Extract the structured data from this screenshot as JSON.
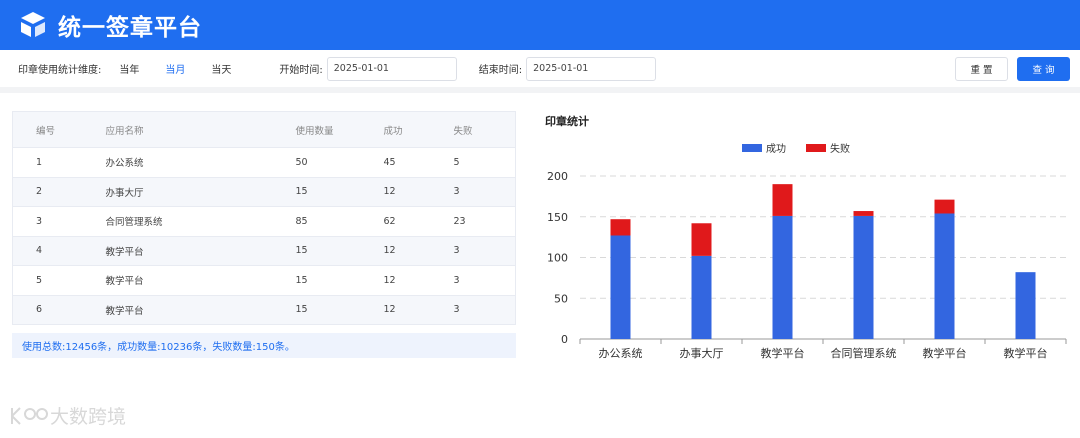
{
  "header": {
    "title": "统一签章平台",
    "logo_icon": "cube-stack-icon"
  },
  "filters": {
    "dimension_label": "印章使用统计维度:",
    "dimension_options": [
      "当年",
      "当月",
      "当天"
    ],
    "active_option": "当月",
    "start_label": "开始时间:",
    "start_value": "2025-01-01",
    "end_label": "结束时间:",
    "end_value": "2025-01-01",
    "reset_label": "重 置",
    "query_label": "查 询"
  },
  "table": {
    "columns": [
      "编号",
      "应用名称",
      "使用数量",
      "成功",
      "失败"
    ],
    "rows": [
      [
        "1",
        "办公系统",
        "50",
        "45",
        "5"
      ],
      [
        "2",
        "办事大厅",
        "15",
        "12",
        "3"
      ],
      [
        "3",
        "合同管理系统",
        "85",
        "62",
        "23"
      ],
      [
        "4",
        "教学平台",
        "15",
        "12",
        "3"
      ],
      [
        "5",
        "教学平台",
        "15",
        "12",
        "3"
      ],
      [
        "6",
        "教学平台",
        "15",
        "12",
        "3"
      ]
    ],
    "summary": "使用总数:12456条，成功数量:10236条，失败数量:150条。"
  },
  "chart_title": "印章统计",
  "chart_data": {
    "type": "bar",
    "stacked": true,
    "categories": [
      "办公系统",
      "办事大厅",
      "教学平台",
      "合同管理系统",
      "教学平台",
      "教学平台"
    ],
    "series": [
      {
        "name": "成功",
        "values": [
          127,
          102,
          151,
          151,
          154,
          82
        ],
        "color": "#3366e0"
      },
      {
        "name": "失败",
        "values": [
          20,
          40,
          39,
          6,
          17,
          0
        ],
        "color": "#e0191b"
      }
    ],
    "ylim": [
      0,
      200
    ],
    "yticks": [
      0,
      50,
      100,
      150,
      200
    ],
    "grid": true,
    "legend": "top-center"
  },
  "watermark": "大数跨境"
}
